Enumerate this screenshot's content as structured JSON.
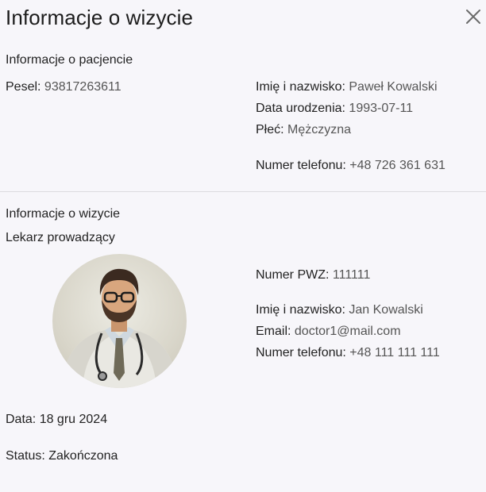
{
  "dialog": {
    "title": "Informacje o wizycie"
  },
  "patient": {
    "section_title": "Informacje o pacjencie",
    "pesel_label": "Pesel:",
    "pesel_value": "93817263611",
    "name_label": "Imię i nazwisko:",
    "name_value": "Paweł Kowalski",
    "birth_label": "Data urodzenia:",
    "birth_value": "1993-07-11",
    "sex_label": "Płeć:",
    "sex_value": "Mężczyzna",
    "phone_label": "Numer telefonu:",
    "phone_value": "+48 726 361 631"
  },
  "visit": {
    "section_title": "Informacje o wizycie",
    "doctor_title": "Lekarz prowadzący",
    "pwz_label": "Numer PWZ:",
    "pwz_value": "111111",
    "name_label": "Imię i nazwisko:",
    "name_value": "Jan Kowalski",
    "email_label": "Email:",
    "email_value": "doctor1@mail.com",
    "phone_label": "Numer telefonu:",
    "phone_value": "+48 111 111 111",
    "date_text": "Data: 18 gru 2024",
    "status_text": "Status: Zakończona"
  },
  "icons": {
    "close": "close-icon",
    "avatar": "doctor-avatar"
  }
}
